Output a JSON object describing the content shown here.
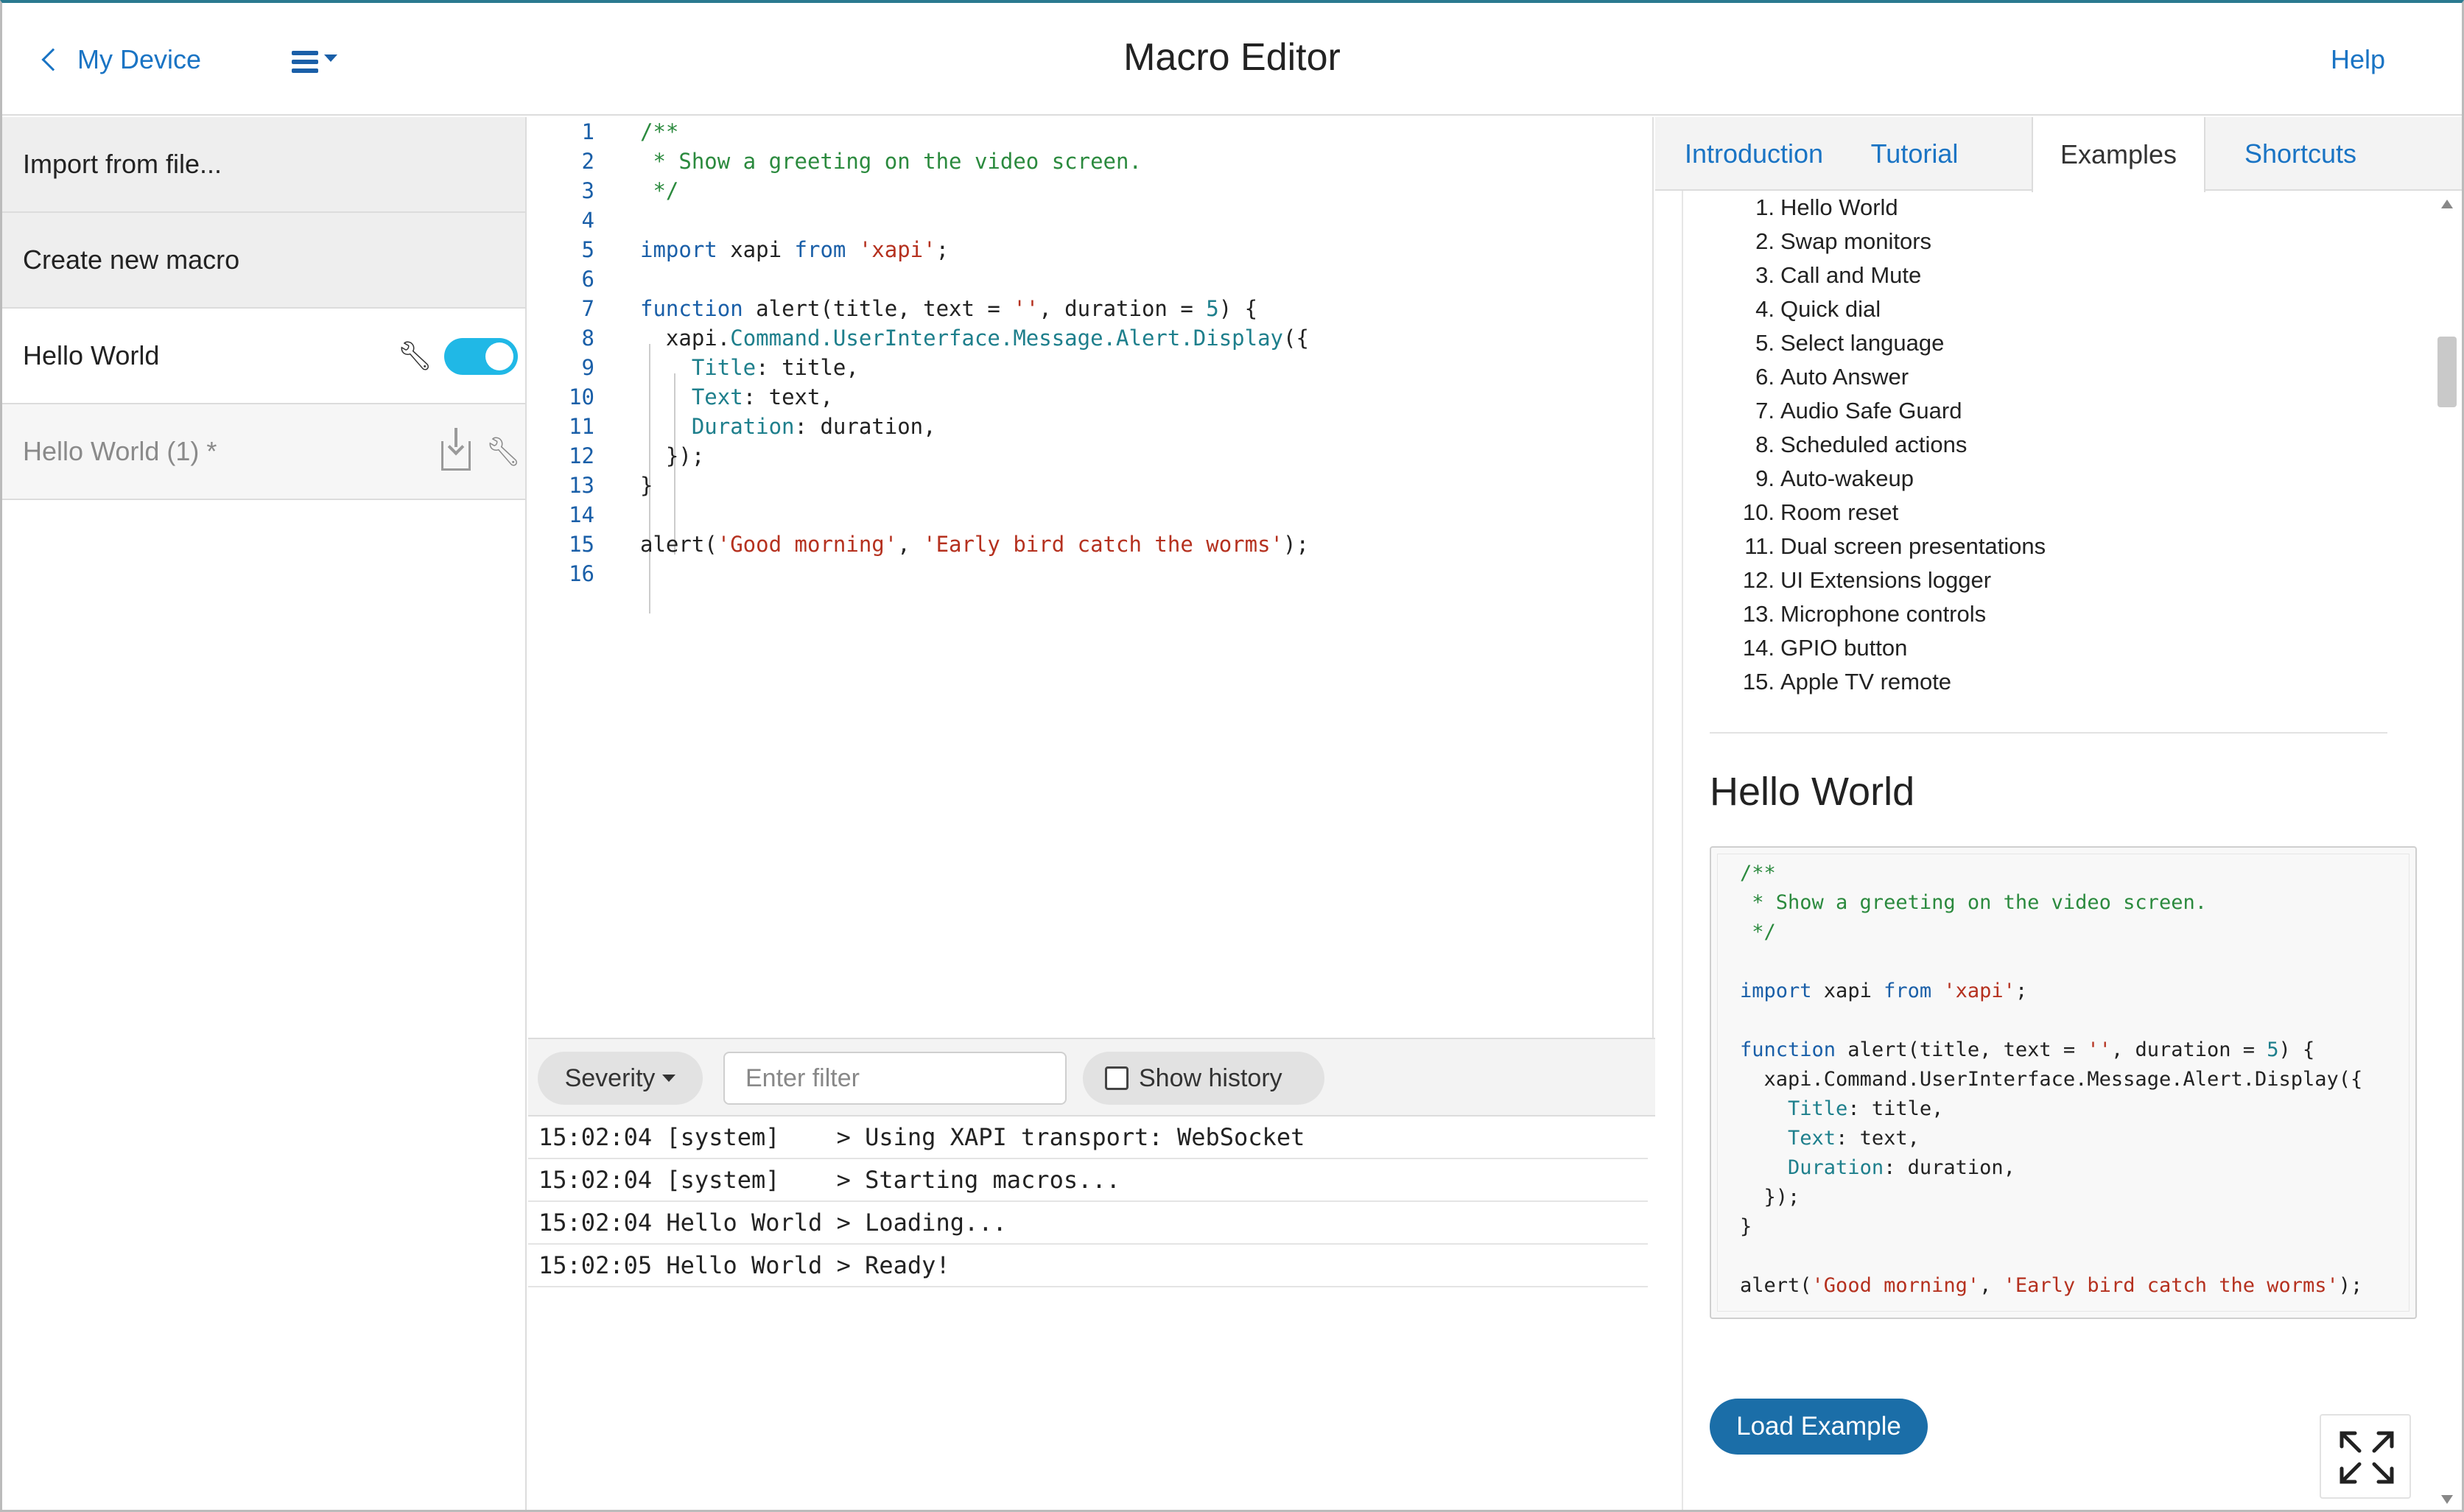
{
  "header": {
    "back_label": "My Device",
    "title": "Macro Editor",
    "help_label": "Help"
  },
  "sidebar": {
    "import_label": "Import from file...",
    "create_label": "Create new macro",
    "macros": [
      {
        "name": "Hello World",
        "enabled": true
      },
      {
        "name": "Hello World (1) *",
        "enabled": false
      }
    ]
  },
  "editor": {
    "line_numbers": [
      "1",
      "2",
      "3",
      "4",
      "5",
      "6",
      "7",
      "8",
      "9",
      "10",
      "11",
      "12",
      "13",
      "14",
      "15",
      "16"
    ]
  },
  "code_text": {
    "l1": "/**",
    "l2": " * Show a greeting on the video screen.",
    "l3": " */",
    "l5_kw": "import",
    "l5_a": " xapi ",
    "l5_from": "from",
    "l5_str": "'xapi'",
    "l5_end": ";",
    "l7_kw": "function",
    "l7_a": " alert(title, text = ",
    "l7_str": "''",
    "l7_b": ", duration = ",
    "l7_num": "5",
    "l7_c": ") {",
    "l8_a": "xapi.",
    "l8_b": "Command.UserInterface.Message.Alert.Display",
    "l8_c": "({",
    "l9_p": "Title",
    "l9_v": ": title,",
    "l10_p": "Text",
    "l10_v": ": text,",
    "l11_p": "Duration",
    "l11_v": ": duration,",
    "l12": "});",
    "l13": "}",
    "l15_a": "alert(",
    "l15_s1": "'Good morning'",
    "l15_b": ", ",
    "l15_s2": "'Early bird catch the worms'",
    "l15_c": ");"
  },
  "log": {
    "severity_label": "Severity",
    "filter_placeholder": "Enter filter",
    "history_label": "Show history",
    "rows": [
      "15:02:04 [system]    > Using XAPI transport: WebSocket",
      "15:02:04 [system]    > Starting macros...",
      "15:02:04 Hello World > Loading...",
      "15:02:05 Hello World > Ready!"
    ]
  },
  "docs": {
    "tabs": [
      "Introduction",
      "Tutorial",
      "Examples",
      "Shortcuts"
    ],
    "active_tab": "Examples",
    "examples": [
      "Hello World",
      "Swap monitors",
      "Call and Mute",
      "Quick dial",
      "Select language",
      "Auto Answer",
      "Audio Safe Guard",
      "Scheduled actions",
      "Auto-wakeup",
      "Room reset",
      "Dual screen presentations",
      "UI Extensions logger",
      "Microphone controls",
      "GPIO button",
      "Apple TV remote"
    ],
    "example_numbers": [
      "1.",
      "2.",
      "3.",
      "4.",
      "5.",
      "6.",
      "7.",
      "8.",
      "9.",
      "10.",
      "11.",
      "12.",
      "13.",
      "14.",
      "15."
    ],
    "selected_heading": "Hello World",
    "load_label": "Load Example"
  },
  "colors": {
    "accent": "#1a74c4",
    "toggle_on": "#20b8e6",
    "load_button": "#1b6ea8",
    "comment": "#2b8a3e",
    "string": "#b5311f",
    "keyword": "#1a5fa8"
  },
  "icons": {
    "back": "chevron-left-icon",
    "menu": "hamburger-icon",
    "settings": "wrench-icon",
    "download": "download-icon",
    "expand": "expand-icon"
  }
}
